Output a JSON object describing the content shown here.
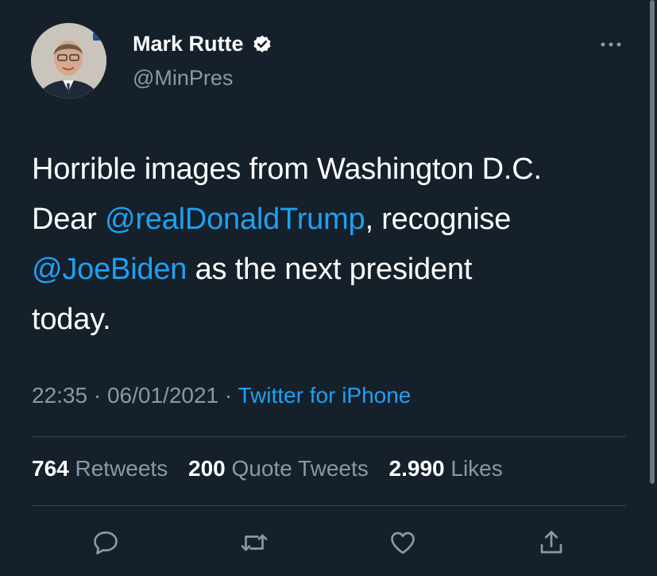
{
  "author": {
    "name": "Mark Rutte",
    "handle": "@MinPres",
    "verified": true
  },
  "tweet": {
    "line1": "Horrible images from Washington D.C.",
    "dear": "Dear ",
    "mention_trump": "@realDonaldTrump",
    "recognise": ", recognise",
    "mention_biden": "@JoeBiden",
    "rest": " as the next president",
    "last": "today."
  },
  "meta": {
    "time": "22:35",
    "sep1": " · ",
    "date": "06/01/2021",
    "sep2": " · ",
    "source": "Twitter for iPhone"
  },
  "stats": {
    "retweets_count": "764",
    "retweets_label": " Retweets",
    "quotes_count": "200",
    "quotes_label": " Quote Tweets",
    "likes_count": "2.990",
    "likes_label": " Likes"
  },
  "icons": [
    "verified-icon",
    "more-icon",
    "reply-icon",
    "retweet-icon",
    "like-icon",
    "share-icon"
  ],
  "colors": {
    "background": "#15202b",
    "accent": "#1da1f2",
    "muted": "#8899a6",
    "divider": "#38444d"
  }
}
